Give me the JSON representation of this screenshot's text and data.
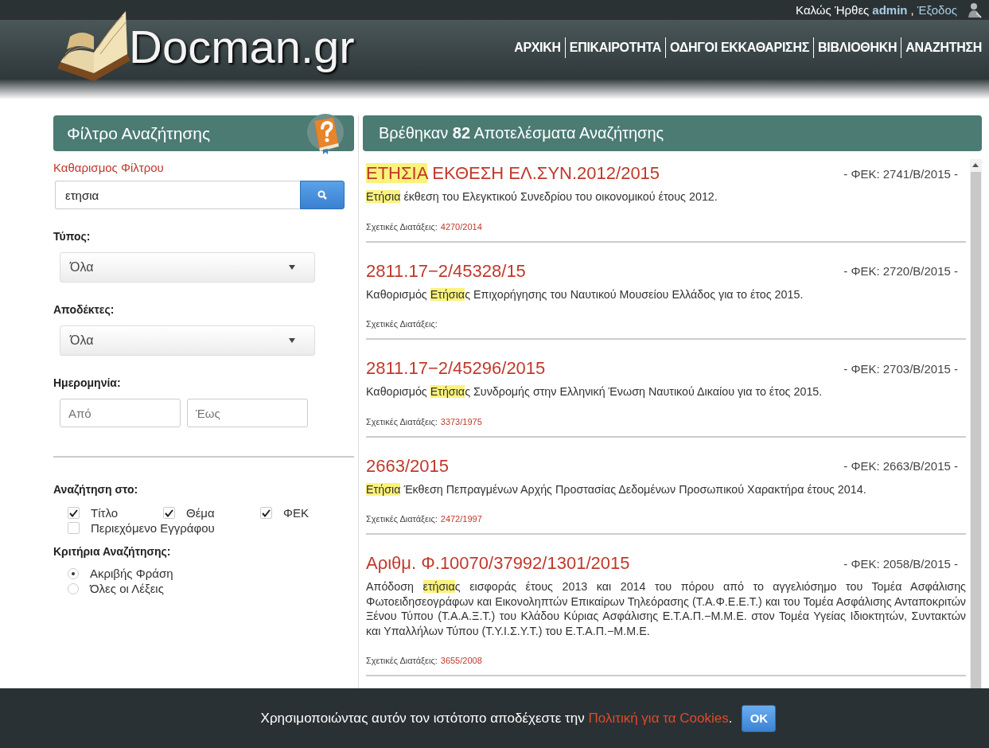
{
  "user_bar": {
    "greeting": "Καλώς Ήρθες",
    "username": "admin",
    "separator": ",",
    "logout": "Έξοδος"
  },
  "logo": {
    "text": "Docman.gr"
  },
  "nav": [
    {
      "label": "ΑΡΧΙΚΗ"
    },
    {
      "label": "ΕΠΙΚΑΙΡΟΤΗΤΑ"
    },
    {
      "label": "ΟΔΗΓΟΙ ΕΚΚΑΘΑΡΙΣΗΣ"
    },
    {
      "label": "ΒΙΒΛΙΟΘΗΚΗ"
    },
    {
      "label": "ΑΝΑΖΗΤΗΣΗ"
    }
  ],
  "filter": {
    "title": "Φίλτρο Αναζήτησης",
    "clear_link": "Καθαρισμος Φίλτρου",
    "search": {
      "value": "ετησια"
    },
    "type": {
      "label": "Τύπος:",
      "value": "Όλα"
    },
    "recipients": {
      "label": "Αποδέκτες:",
      "value": "Όλα"
    },
    "date": {
      "label": "Ημερομηνία:",
      "from_placeholder": "Από",
      "to_placeholder": "Έως"
    },
    "search_in": {
      "label": "Αναζήτηση στο:",
      "options": [
        {
          "label": "Τίτλο",
          "checked": true
        },
        {
          "label": "Θέμα",
          "checked": true
        },
        {
          "label": "ΦΕΚ",
          "checked": true
        },
        {
          "label": "Περιεχόμενο Εγγράφου",
          "checked": false
        }
      ]
    },
    "criteria": {
      "label": "Κριτήρια Αναζήτησης:",
      "options": [
        {
          "label": "Ακριβής Φράση",
          "selected": true
        },
        {
          "label": "Όλες οι Λέξεις",
          "selected": false
        }
      ]
    }
  },
  "results": {
    "heading": "Βρέθηκαν **82** Αποτελέσματα Αναζήτησης",
    "items": [
      {
        "title": [
          {
            "text": "ΕΤΗΣΙΑ",
            "highlighted": true
          },
          {
            "text": " ΕΚΘΕΣΗ ΕΛ.ΣΥΝ.2012/2015",
            "highlighted": false
          }
        ],
        "fek": "- ΦΕΚ: 2741/Β/2015 -",
        "summary": [
          {
            "text": "Ετήσια",
            "highlighted": true
          },
          {
            "text": " έκθεση του Ελεγκτικού Συνεδρίου του οικονομικού έτους 2012.",
            "highlighted": false
          }
        ],
        "related_label": "Σχετικές Διατάξεις:",
        "related_link": "4270/2014"
      },
      {
        "title": [
          {
            "text": "2811.17−2/45328/15",
            "highlighted": false
          }
        ],
        "fek": "- ΦΕΚ: 2720/Β/2015 -",
        "summary": [
          {
            "text": "Καθορισμός ",
            "highlighted": false
          },
          {
            "text": "Ετήσια",
            "highlighted": true
          },
          {
            "text": "ς Επιχορήγησης του Ναυτικού Μουσείου Ελλάδος για το έτος 2015.",
            "highlighted": false
          }
        ],
        "related_label": "Σχετικές Διατάξεις:"
      },
      {
        "title": [
          {
            "text": "2811.17−2/45296/2015",
            "highlighted": false
          }
        ],
        "fek": "- ΦΕΚ: 2703/Β/2015 -",
        "summary": [
          {
            "text": "Καθορισμός ",
            "highlighted": false
          },
          {
            "text": "Ετήσια",
            "highlighted": true
          },
          {
            "text": "ς Συνδρομής στην Ελληνική Ένωση Ναυτικού Δικαίου για το έτος 2015.",
            "highlighted": false
          }
        ],
        "related_label": "Σχετικές Διατάξεις:",
        "related_link": "3373/1975"
      },
      {
        "title": [
          {
            "text": "2663/2015",
            "highlighted": false
          }
        ],
        "fek": "- ΦΕΚ: 2663/Β/2015 -",
        "summary": [
          {
            "text": "Ετήσια",
            "highlighted": true
          },
          {
            "text": " Έκθεση Πεπραγμένων Αρχής Προστασίας Δεδομένων Προσωπικού Χαρακτήρα έτους 2014.",
            "highlighted": false
          }
        ],
        "related_label": "Σχετικές Διατάξεις:",
        "related_link": "2472/1997"
      },
      {
        "title": [
          {
            "text": "Αριθμ. Φ.10070/37992/1301/2015",
            "highlighted": false
          }
        ],
        "fek": "- ΦΕΚ: 2058/Β/2015 -",
        "summary": [
          {
            "text": "Απόδοση ",
            "highlighted": false
          },
          {
            "text": "ετήσια",
            "highlighted": true
          },
          {
            "text": "ς εισφοράς έτους 2013 και 2014 του πόρου από το αγγελιόσημο του Τομέα Ασφάλισης Φωτοειδησεογράφων και Εικονοληπτών Επικαίρων Τηλεόρασης (Τ.Α.Φ.Ε.Ε.Τ.) και του Τομέα Ασφάλισης Ανταποκριτών Ξένου Τύπου (Τ.Α.Α.Ξ.Τ.) του Κλάδου Κύριας Ασφάλισης Ε.Τ.Α.Π.−Μ.Μ.Ε. στον Τομέα Υγείας Ιδιοκτητών, Συντακτών και Υπαλλήλων Τύπου (Τ.Υ.Ι.Σ.Υ.Τ.) του Ε.Τ.Α.Π.−Μ.Μ.Ε.",
            "highlighted": false
          }
        ],
        "related_label": "Σχετικές Διατάξεις:",
        "related_link": "3655/2008"
      }
    ]
  },
  "cookie": {
    "text": "Χρησιμοποιώντας αυτόν τον ιστότοπο αποδέχεστε την",
    "link": "Πολιτική για τα Cookies",
    "after": ".",
    "button": "OK"
  }
}
